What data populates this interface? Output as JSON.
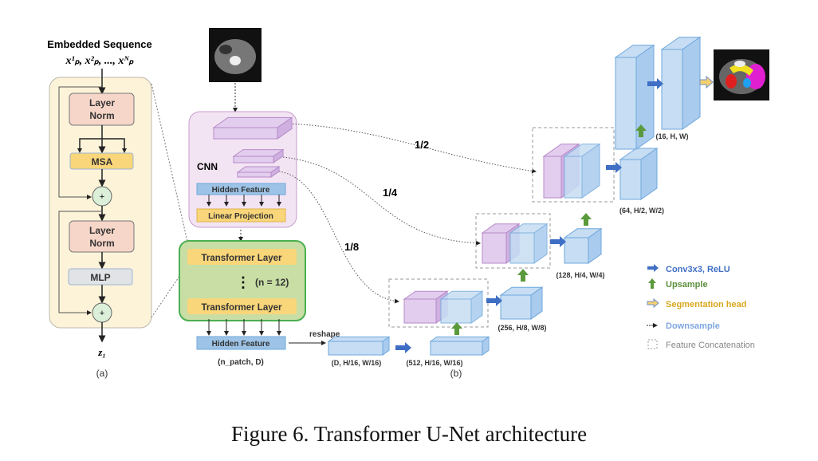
{
  "panel_a": {
    "title": "Embedded Sequence",
    "input": "x¹ₚ, x²ₚ, ..., xᴺₚ",
    "layer_norm_1": [
      "Layer",
      "Norm"
    ],
    "msa": "MSA",
    "plus_1": "+",
    "layer_norm_2": [
      "Layer",
      "Norm"
    ],
    "mlp": "MLP",
    "plus_2": "+",
    "output": "z₁",
    "label": "(a)"
  },
  "panel_b": {
    "cnn_label": "CNN",
    "hidden_feature_top": "Hidden Feature",
    "linear_projection": "Linear Projection",
    "transformer_layer_1": "Transformer Layer",
    "repeat": "(n = 12)",
    "transformer_layer_2": "Transformer Layer",
    "hidden_feature_bottom": "Hidden Feature",
    "hidden_shape": "(n_patch, D)",
    "reshape": "reshape",
    "skip_labels": [
      "1/2",
      "1/4",
      "1/8"
    ],
    "shapes": {
      "d": "(D, H/16, W/16)",
      "s512": "(512, H/16, W/16)",
      "s256": "(256, H/8, W/8)",
      "s128": "(128, H/4, W/4)",
      "s64": "(64, H/2, W/2)",
      "s16": "(16, H, W)"
    },
    "label": "(b)"
  },
  "legend": [
    {
      "label": "Conv3x3, ReLU",
      "icon": "blue-arrow-right-icon",
      "color": "#3f6fc4"
    },
    {
      "label": "Upsample",
      "icon": "green-arrow-up-icon",
      "color": "#5a8f3c"
    },
    {
      "label": "Segmentation head",
      "icon": "hollow-arrow-right-icon",
      "color": "#d9a820"
    },
    {
      "label": "Downsample",
      "icon": "small-arrow-right-icon",
      "color": "#7fa6e0"
    },
    {
      "label": "Feature Concatenation",
      "icon": "dashed-square-icon",
      "color": "#888888"
    }
  ],
  "caption": "Figure 6. Transformer U-Net architecture"
}
